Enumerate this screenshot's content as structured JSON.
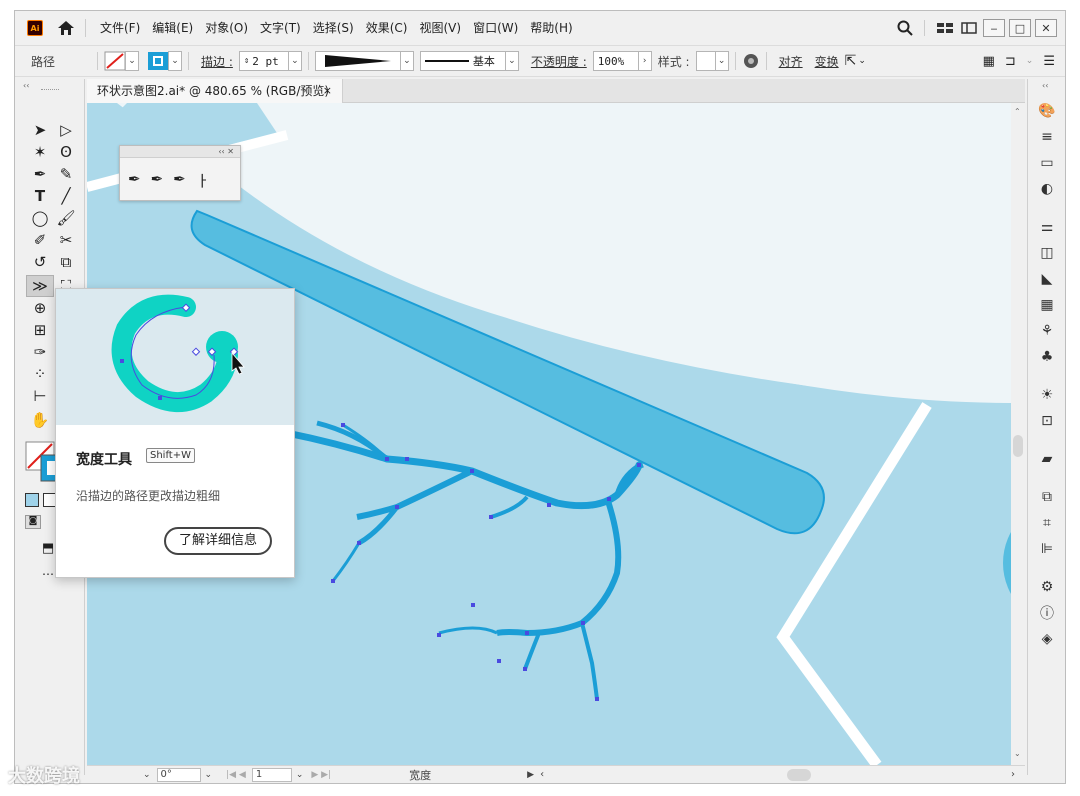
{
  "app": {
    "logo_text": "Ai"
  },
  "menu": {
    "items": [
      "文件(F)",
      "编辑(E)",
      "对象(O)",
      "文字(T)",
      "选择(S)",
      "效果(C)",
      "视图(V)",
      "窗口(W)",
      "帮助(H)"
    ]
  },
  "control": {
    "selection_label": "路径",
    "stroke_label": "描边 :",
    "stroke_value": "2 pt",
    "brush_label": "基本",
    "opacity_label": "不透明度 :",
    "opacity_value": "100%",
    "style_label": "样式 :",
    "align_label": "对齐",
    "transform_label": "变换"
  },
  "document": {
    "tab_title": "环状示意图2.ai* @ 480.65 % (RGB/预览)",
    "close_symbol": "×"
  },
  "tooltip": {
    "title": "宽度工具",
    "shortcut": "Shift+W",
    "description": "沿描边的路径更改描边粗细",
    "learn_more": "了解详细信息"
  },
  "statusbar": {
    "rotation": "0°",
    "artboard": "1",
    "tool_name": "宽度"
  },
  "watermark": "大数跨境",
  "colors": {
    "canvas_bg": "#eef5f8",
    "light_blue": "#acd9ea",
    "mid_blue": "#56bde0",
    "stroke_blue": "#1b9ed6",
    "anchor": "#4a4ae0",
    "tooltip_teal": "#0fd3c4"
  }
}
